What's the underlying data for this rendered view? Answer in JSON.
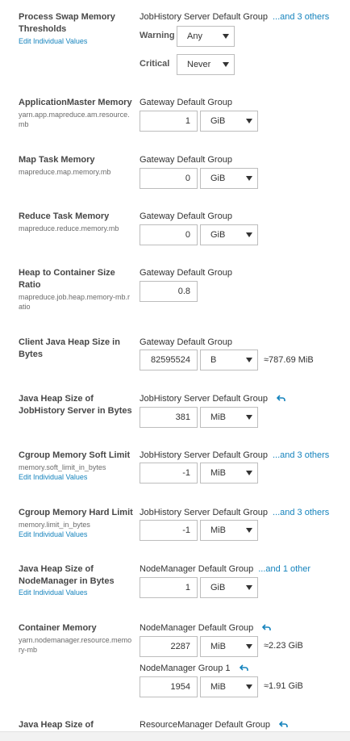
{
  "props": {
    "swap": {
      "name": "Process Swap Memory Thresholds",
      "link": "Edit Individual Values",
      "group": "JobHistory Server Default Group",
      "more": "...and 3 others",
      "warning_label": "Warning",
      "warning_value": "Any",
      "critical_label": "Critical",
      "critical_value": "Never"
    },
    "am_mem": {
      "name": "ApplicationMaster Memory",
      "key": "yarn.app.mapreduce.am.resource.mb",
      "group": "Gateway Default Group",
      "value": "1",
      "unit": "GiB"
    },
    "map_mem": {
      "name": "Map Task Memory",
      "key": "mapreduce.map.memory.mb",
      "group": "Gateway Default Group",
      "value": "0",
      "unit": "GiB"
    },
    "reduce_mem": {
      "name": "Reduce Task Memory",
      "key": "mapreduce.reduce.memory.mb",
      "group": "Gateway Default Group",
      "value": "0",
      "unit": "GiB"
    },
    "heap_ratio": {
      "name": "Heap to Container Size Ratio",
      "key": "mapreduce.job.heap.memory-mb.ratio",
      "group": "Gateway Default Group",
      "value": "0.8"
    },
    "client_heap": {
      "name": "Client Java Heap Size in Bytes",
      "group": "Gateway Default Group",
      "value": "82595524",
      "unit": "B",
      "approx": "≈787.69 MiB"
    },
    "jh_heap": {
      "name": "Java Heap Size of JobHistory Server in Bytes",
      "group": "JobHistory Server Default Group",
      "value": "381",
      "unit": "MiB"
    },
    "cg_soft": {
      "name": "Cgroup Memory Soft Limit",
      "key": "memory.soft_limit_in_bytes",
      "link": "Edit Individual Values",
      "group": "JobHistory Server Default Group",
      "more": "...and 3 others",
      "value": "-1",
      "unit": "MiB"
    },
    "cg_hard": {
      "name": "Cgroup Memory Hard Limit",
      "key": "memory.limit_in_bytes",
      "link": "Edit Individual Values",
      "group": "JobHistory Server Default Group",
      "more": "...and 3 others",
      "value": "-1",
      "unit": "MiB"
    },
    "nm_heap": {
      "name": "Java Heap Size of NodeManager in Bytes",
      "link": "Edit Individual Values",
      "group": "NodeManager Default Group",
      "more": "...and 1 other",
      "value": "1",
      "unit": "GiB"
    },
    "container_mem": {
      "name": "Container Memory",
      "key": "yarn.nodemanager.resource.memory-mb",
      "group": "NodeManager Default Group",
      "value": "2287",
      "unit": "MiB",
      "approx": "≈2.23 GiB",
      "group2": "NodeManager Group 1",
      "value2": "1954",
      "unit2": "MiB",
      "approx2": "≈1.91 GiB"
    },
    "rm_heap": {
      "name": "Java Heap Size of",
      "group": "ResourceManager Default Group"
    }
  },
  "icons": {
    "undo": "undo-arrow-icon",
    "dropdown": "chevron-down-icon"
  },
  "colors": {
    "link": "#1583bd",
    "label": "#474747",
    "border": "#bdbdbd"
  }
}
